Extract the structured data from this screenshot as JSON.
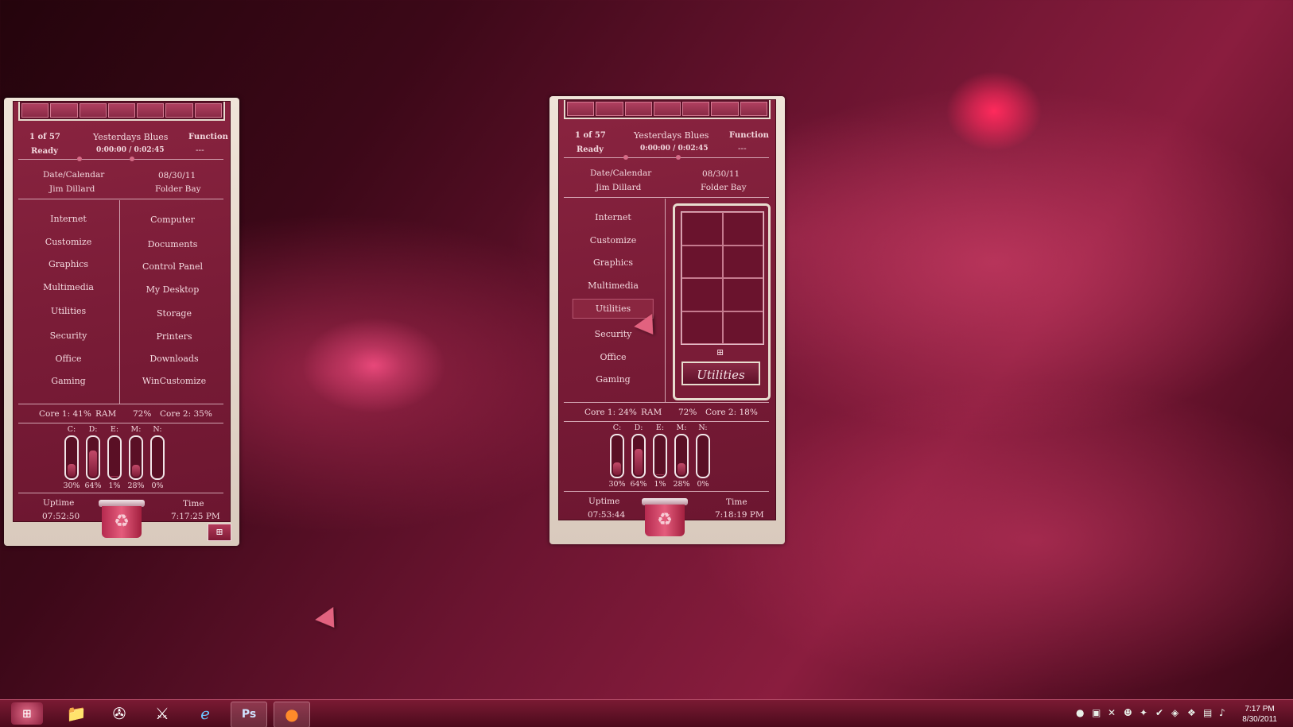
{
  "widget": {
    "track": "1 of 57",
    "song": "Yesterdays Blues",
    "function_label": "Function",
    "status": "Ready",
    "time_progress": "0:00:00 / 0:02:45",
    "function_value": "---",
    "date_calendar": "Date/Calendar",
    "date": "08/30/11",
    "user": "Jim Dillard",
    "folder_bay": "Folder Bay",
    "menu_left": [
      "Internet",
      "Customize",
      "Graphics",
      "Multimedia",
      "Utilities",
      "Security",
      "Office",
      "Gaming"
    ],
    "menu_right": [
      "Computer",
      "Documents",
      "Control Panel",
      "My Desktop",
      "Storage",
      "Printers",
      "Downloads",
      "WinCustomize"
    ],
    "drives": [
      {
        "label": "C:",
        "pct": "30%",
        "value": 0.3
      },
      {
        "label": "D:",
        "pct": "64%",
        "value": 0.64
      },
      {
        "label": "E:",
        "pct": "1%",
        "value": 0.01
      },
      {
        "label": "M:",
        "pct": "28%",
        "value": 0.28
      },
      {
        "label": "N:",
        "pct": "0%",
        "value": 0.0
      }
    ],
    "uptime_label": "Uptime",
    "time_label": "Time",
    "ram_label": "RAM",
    "ram_value": "72%"
  },
  "left": {
    "core1": "Core 1:  41%",
    "core2": "Core 2:  35%",
    "uptime": "07:52:50",
    "time": "7:17:25  PM"
  },
  "right": {
    "core1": "Core 1:  24%",
    "core2": "Core 2:  18%",
    "uptime": "07:53:44",
    "time": "7:18:19  PM",
    "panel_title": "Utilities"
  },
  "icons": {
    "windows_logo": "⊞",
    "recycle": "♻"
  },
  "taskbar": {
    "apps": [
      "Windows Explorer",
      "Utility",
      "Game",
      "Internet Explorer",
      "Ps",
      "Firefox"
    ],
    "clock_time": "7:17 PM",
    "clock_date": "8/30/2011"
  },
  "colors": {
    "accent": "#7a1c37",
    "frame": "#e8dccf",
    "text": "#f3d8de"
  }
}
